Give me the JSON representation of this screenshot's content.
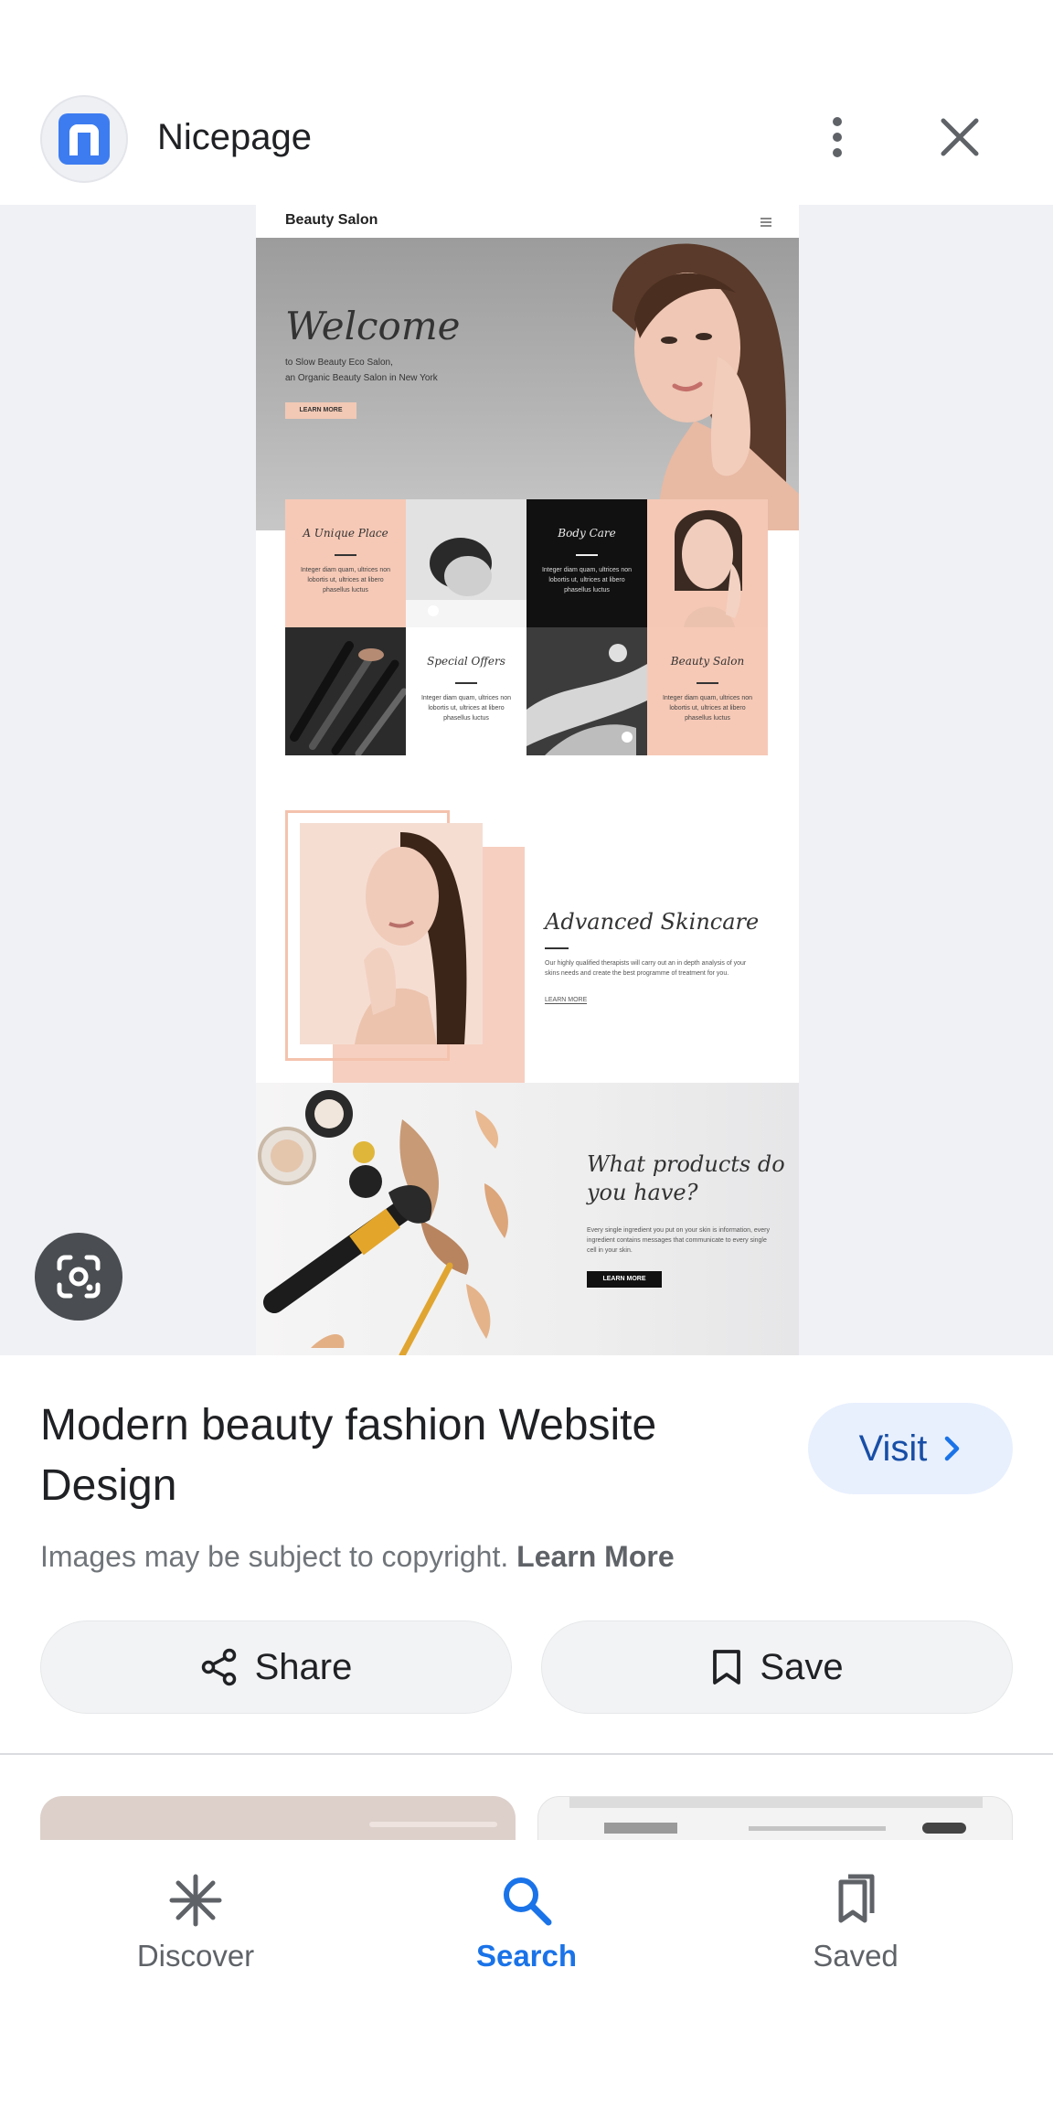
{
  "header": {
    "source_name": "Nicepage",
    "more_icon": "more-vert-icon",
    "close_icon": "close-icon"
  },
  "preview": {
    "brand": "Beauty Salon",
    "hero": {
      "heading": "Welcome",
      "line1": "to Slow Beauty Eco Salon,",
      "line2": "an Organic Beauty Salon in New York",
      "button": "LEARN MORE"
    },
    "cards": [
      {
        "title": "A Unique Place",
        "body": "Integer diam quam, ultrices non lobortis ut, ultrices at libero phasellus luctus"
      },
      {
        "title": "Body Care",
        "body": "Integer diam quam, ultrices non lobortis ut, ultrices at libero phasellus luctus"
      },
      {
        "title": "Special Offers",
        "body": "Integer diam quam, ultrices non lobortis ut, ultrices at libero phasellus luctus"
      },
      {
        "title": "Beauty Salon",
        "body": "Integer diam quam, ultrices non lobortis ut, ultrices at libero phasellus luctus"
      }
    ],
    "skincare": {
      "title": "Advanced Skincare",
      "body": "Our highly qualified therapists will carry out an in depth analysis of your skins needs and create the best programme of treatment for you.",
      "link": "LEARN MORE"
    },
    "products": {
      "title_line1": "What products do",
      "title_line2": "you have?",
      "body": "Every single ingredient you put on your skin is information, every ingredient contains messages that communicate to every single cell in your skin.",
      "button": "LEARN MORE"
    }
  },
  "lens_icon": "google-lens-icon",
  "info": {
    "title": "Modern beauty fashion Website Design",
    "visit_label": "Visit",
    "copyright_text": "Images may be subject to copyright.",
    "learn_more": "Learn More",
    "share_label": "Share",
    "save_label": "Save"
  },
  "nav": {
    "items": [
      {
        "label": "Discover",
        "icon": "asterisk-icon",
        "active": false
      },
      {
        "label": "Search",
        "icon": "search-icon",
        "active": true
      },
      {
        "label": "Saved",
        "icon": "saved-bookmarks-icon",
        "active": false
      }
    ]
  },
  "colors": {
    "accent": "#1a73e8",
    "visit_bg": "#e8f0fe",
    "viewer_bg": "#eff1f5",
    "peach": "#f6cfc0"
  }
}
